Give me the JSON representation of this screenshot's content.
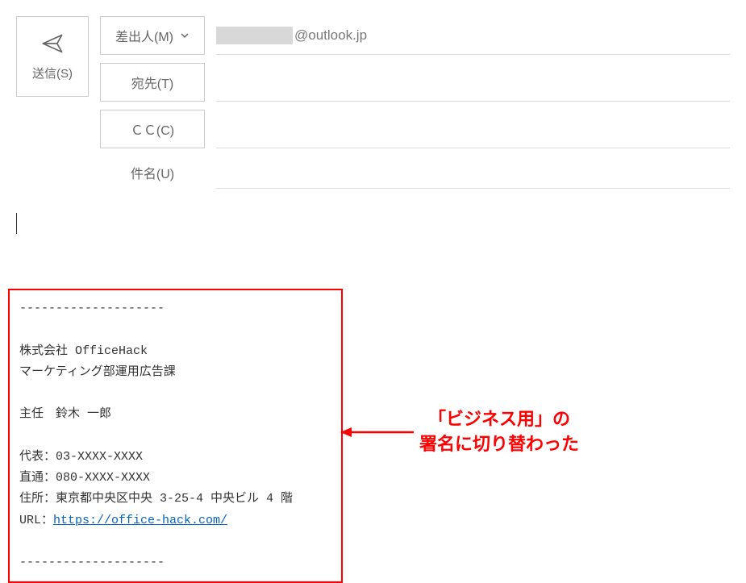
{
  "compose": {
    "send_label": "送信(S)",
    "from_label": "差出人(M)",
    "to_label": "宛先(T)",
    "cc_label": "ＣＣ(C)",
    "subject_label": "件名(U)",
    "from_value_suffix": "@outlook.jp",
    "to_value": "",
    "cc_value": "",
    "subject_value": ""
  },
  "signature": {
    "divider_top": "--------------------",
    "company": "株式会社 OfficeHack",
    "department": "マーケティング部運用広告課",
    "title_name": "主任　鈴木 一郎",
    "tel_main": "代表：03-XXXX-XXXX",
    "tel_direct": "直通：080-XXXX-XXXX",
    "address": "住所：東京都中央区中央 3-25-4 中央ビル 4 階",
    "url_label": "URL：",
    "url_link": "https://office-hack.com/",
    "divider_bottom": "--------------------"
  },
  "annotation": {
    "line1": "「ビジネス用」の",
    "line2": "署名に切り替わった"
  }
}
